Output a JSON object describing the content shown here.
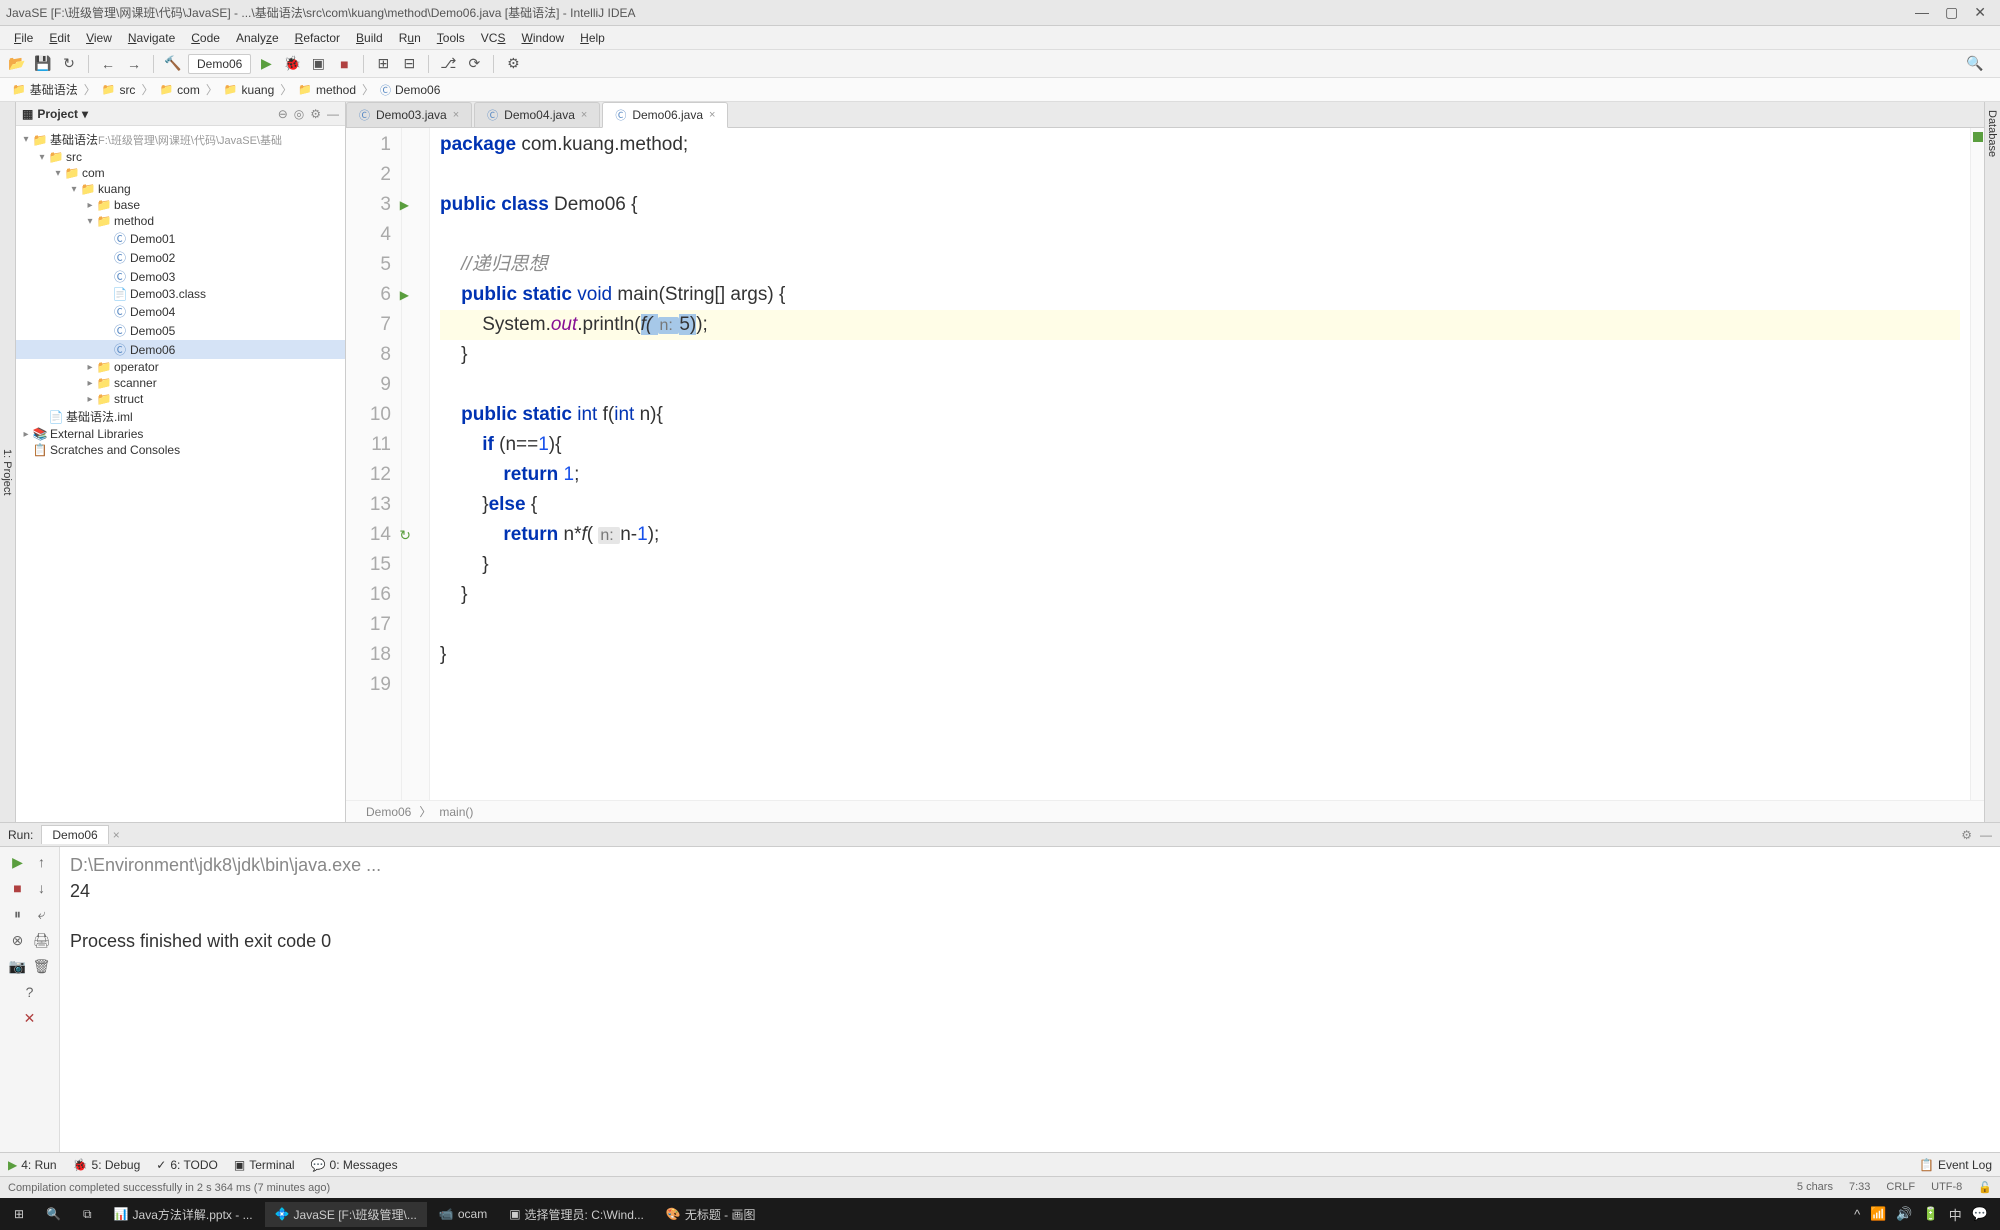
{
  "window": {
    "title": "JavaSE [F:\\班级管理\\网课班\\代码\\JavaSE] - ...\\基础语法\\src\\com\\kuang\\method\\Demo06.java [基础语法] - IntelliJ IDEA"
  },
  "menu": [
    "File",
    "Edit",
    "View",
    "Navigate",
    "Code",
    "Analyze",
    "Refactor",
    "Build",
    "Run",
    "Tools",
    "VCS",
    "Window",
    "Help"
  ],
  "toolbar": {
    "run_config": "Demo06"
  },
  "breadcrumb": {
    "root": "基础语法",
    "items": [
      "src",
      "com",
      "kuang",
      "method",
      "Demo06"
    ]
  },
  "project": {
    "title": "Project",
    "root_name": "基础语法",
    "root_path": "F:\\班级管理\\网课班\\代码\\JavaSE\\基础",
    "tree": {
      "src": "src",
      "com": "com",
      "kuang": "kuang",
      "base": "base",
      "method": "method",
      "classes": [
        "Demo01",
        "Demo02",
        "Demo03",
        "Demo03.class",
        "Demo04",
        "Demo05",
        "Demo06"
      ],
      "operator": "operator",
      "scanner": "scanner",
      "struct": "struct",
      "iml": "基础语法.iml",
      "external": "External Libraries",
      "scratches": "Scratches and Consoles"
    }
  },
  "tabs": [
    {
      "name": "Demo03.java",
      "active": false
    },
    {
      "name": "Demo04.java",
      "active": false
    },
    {
      "name": "Demo06.java",
      "active": true
    }
  ],
  "code": {
    "lines": [
      {
        "n": 1,
        "parts": [
          {
            "t": "package ",
            "c": "kw"
          },
          {
            "t": "com.kuang.method;"
          }
        ]
      },
      {
        "n": 2,
        "parts": []
      },
      {
        "n": 3,
        "run": true,
        "parts": [
          {
            "t": "public class ",
            "c": "kw"
          },
          {
            "t": "Demo06 {"
          }
        ]
      },
      {
        "n": 4,
        "parts": []
      },
      {
        "n": 5,
        "parts": [
          {
            "t": "    "
          },
          {
            "t": "//递归思想",
            "c": "cmt"
          }
        ]
      },
      {
        "n": 6,
        "run": true,
        "parts": [
          {
            "t": "    "
          },
          {
            "t": "public static ",
            "c": "kw"
          },
          {
            "t": "void ",
            "c": "type"
          },
          {
            "t": "main(String[] args) {"
          }
        ]
      },
      {
        "n": 7,
        "hl": true,
        "parts": [
          {
            "t": "        System."
          },
          {
            "t": "out",
            "c": "field"
          },
          {
            "t": ".println("
          },
          {
            "t": "f( ",
            "c": "sel italic"
          },
          {
            "t": "n: ",
            "c": "sel hint"
          },
          {
            "t": "5)",
            "c": "sel"
          },
          {
            "t": ");"
          }
        ]
      },
      {
        "n": 8,
        "parts": [
          {
            "t": "    }"
          }
        ]
      },
      {
        "n": 9,
        "parts": []
      },
      {
        "n": 10,
        "parts": [
          {
            "t": "    "
          },
          {
            "t": "public static ",
            "c": "kw"
          },
          {
            "t": "int ",
            "c": "type"
          },
          {
            "t": "f("
          },
          {
            "t": "int ",
            "c": "type"
          },
          {
            "t": "n){"
          }
        ]
      },
      {
        "n": 11,
        "parts": [
          {
            "t": "        "
          },
          {
            "t": "if ",
            "c": "kw"
          },
          {
            "t": "(n=="
          },
          {
            "t": "1",
            "c": "num"
          },
          {
            "t": "){"
          }
        ]
      },
      {
        "n": 12,
        "parts": [
          {
            "t": "            "
          },
          {
            "t": "return ",
            "c": "kw"
          },
          {
            "t": "1",
            "c": "num"
          },
          {
            "t": ";"
          }
        ]
      },
      {
        "n": 13,
        "parts": [
          {
            "t": "        }"
          },
          {
            "t": "else ",
            "c": "kw"
          },
          {
            "t": "{"
          }
        ]
      },
      {
        "n": 14,
        "recur": true,
        "parts": [
          {
            "t": "            "
          },
          {
            "t": "return ",
            "c": "kw"
          },
          {
            "t": "n*"
          },
          {
            "t": "f",
            "c": "italic"
          },
          {
            "t": "( "
          },
          {
            "t": "n: ",
            "c": "hint"
          },
          {
            "t": "n-"
          },
          {
            "t": "1",
            "c": "num"
          },
          {
            "t": ");"
          }
        ]
      },
      {
        "n": 15,
        "parts": [
          {
            "t": "        }"
          }
        ]
      },
      {
        "n": 16,
        "parts": [
          {
            "t": "    }"
          }
        ]
      },
      {
        "n": 17,
        "parts": []
      },
      {
        "n": 18,
        "parts": [
          {
            "t": "}"
          }
        ]
      },
      {
        "n": 19,
        "parts": []
      }
    ]
  },
  "breadcrumb_bottom": {
    "class": "Demo06",
    "method": "main()"
  },
  "run": {
    "label": "Run:",
    "config": "Demo06",
    "output_path": "D:\\Environment\\jdk8\\jdk\\bin\\java.exe ...",
    "output_val": "24",
    "exit": "Process finished with exit code 0"
  },
  "bottom_tools": {
    "run": "4: Run",
    "debug": "5: Debug",
    "todo": "6: TODO",
    "terminal": "Terminal",
    "messages": "0: Messages",
    "eventlog": "Event Log"
  },
  "status": {
    "msg": "Compilation completed successfully in 2 s 364 ms (7 minutes ago)",
    "chars": "5 chars",
    "pos": "7:33",
    "crlf": "CRLF",
    "enc": "UTF-8"
  },
  "taskbar": {
    "items": [
      "Java方法详解.pptx - ...",
      "JavaSE [F:\\班级管理\\...",
      "ocam",
      "选择管理员: C:\\Wind...",
      "无标题 - 画图"
    ]
  }
}
